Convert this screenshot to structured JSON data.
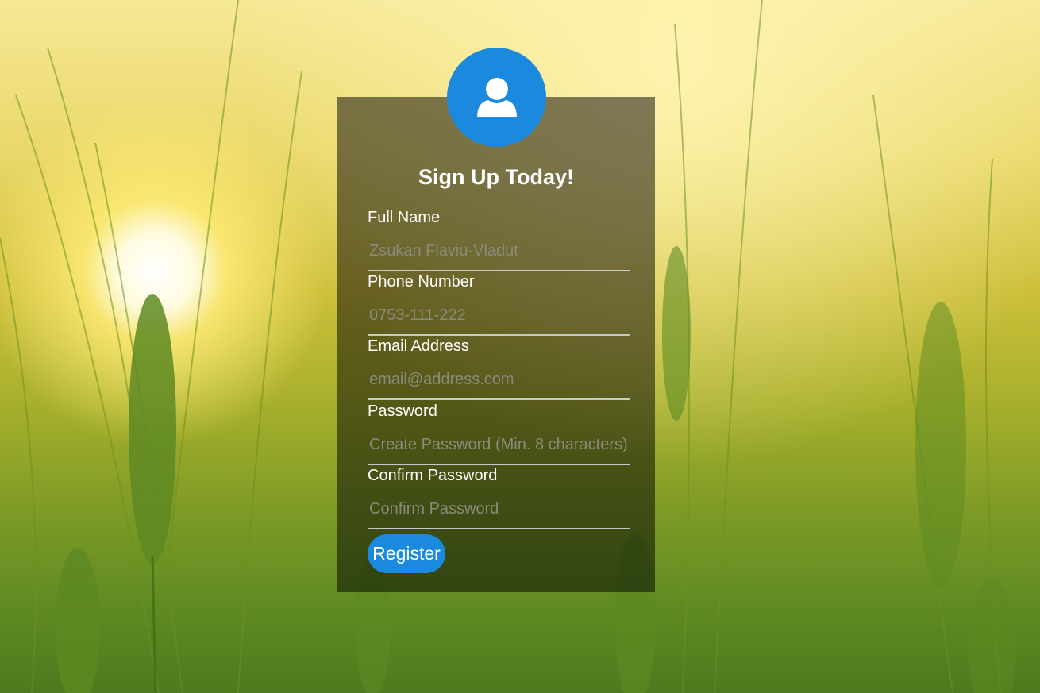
{
  "form": {
    "title": "Sign Up Today!",
    "fields": [
      {
        "label": "Full Name",
        "placeholder": "Zsukan Flaviu-Vladut",
        "value": ""
      },
      {
        "label": "Phone Number",
        "placeholder": "0753-111-222",
        "value": ""
      },
      {
        "label": "Email Address",
        "placeholder": "email@address.com",
        "value": ""
      },
      {
        "label": "Password",
        "placeholder": "Create Password (Min. 8 characters)",
        "value": ""
      },
      {
        "label": "Confirm Password",
        "placeholder": "Confirm Password",
        "value": ""
      }
    ],
    "submit_label": "Register"
  },
  "icons": {
    "avatar": "user-icon"
  },
  "colors": {
    "accent": "#1b8ade",
    "panel_overlay": "rgba(0,0,0,0.5)",
    "text": "#ffffff",
    "underline": "#c8c8c8"
  }
}
